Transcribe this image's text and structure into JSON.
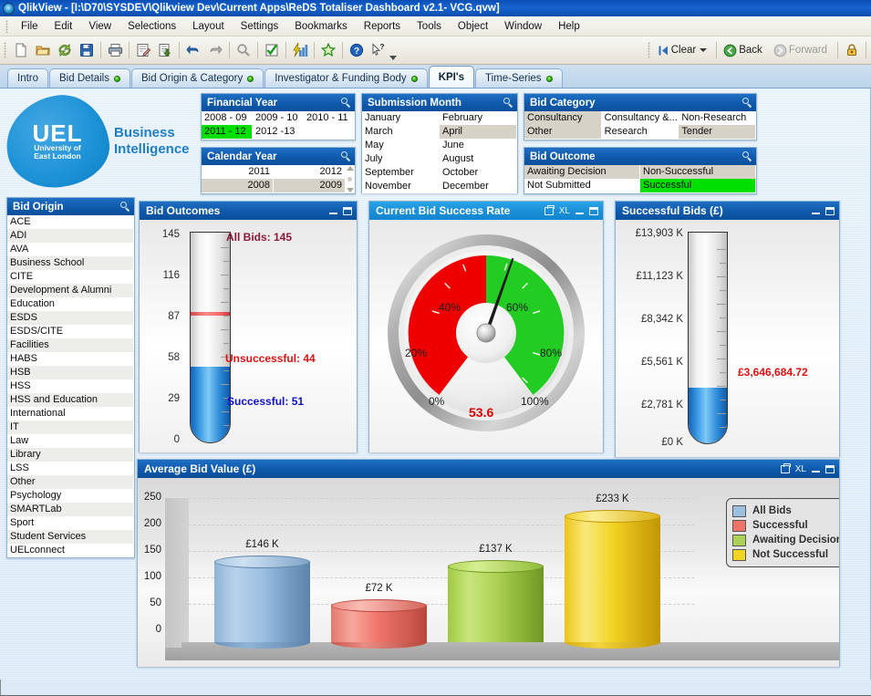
{
  "window": {
    "title": "QlikView - [I:\\D70\\SYSDEV\\Qlikview Dev\\Current Apps\\ReDS Totaliser Dashboard v2.1- VCG.qvw]",
    "app_icon": "qlikview-icon"
  },
  "menu": [
    "File",
    "Edit",
    "View",
    "Selections",
    "Layout",
    "Settings",
    "Bookmarks",
    "Reports",
    "Tools",
    "Object",
    "Window",
    "Help"
  ],
  "toolbar": {
    "buttons": [
      "new-document-icon",
      "open-folder-icon",
      "reload-icon",
      "save-icon",
      "print-icon",
      "edit-script-icon",
      "export-icon",
      "undo-icon",
      "redo-icon",
      "search-icon",
      "check-icon",
      "quick-chart-icon",
      "favorite-icon",
      "help-icon",
      "context-help-icon"
    ],
    "clear_label": "Clear",
    "back_label": "Back",
    "forward_label": "Forward",
    "lock_icon": "lock-icon"
  },
  "tabs": [
    {
      "label": "Intro",
      "dot": false,
      "active": false
    },
    {
      "label": "Bid Details",
      "dot": true,
      "active": false
    },
    {
      "label": "Bid Origin & Category",
      "dot": true,
      "active": false
    },
    {
      "label": "Investigator & Funding Body",
      "dot": true,
      "active": false
    },
    {
      "label": "KPI's",
      "dot": false,
      "active": true
    },
    {
      "label": "Time-Series",
      "dot": true,
      "active": false
    }
  ],
  "logo": {
    "acronym": "UEL",
    "line1": "University of",
    "line2": "East London",
    "bi_line1": "Business",
    "bi_line2": "Intelligence"
  },
  "filters": {
    "financial_year": {
      "title": "Financial Year",
      "rows": [
        [
          {
            "t": "2008 - 09",
            "s": "plain"
          },
          {
            "t": "2009 - 10",
            "s": "plain"
          },
          {
            "t": "2010 - 11",
            "s": "plain"
          }
        ],
        [
          {
            "t": "2011 - 12",
            "s": "sel-green"
          },
          {
            "t": "2012 -13",
            "s": "plain"
          },
          {
            "t": "",
            "s": "empty"
          }
        ]
      ]
    },
    "calendar_year": {
      "title": "Calendar Year",
      "rows": [
        [
          {
            "t": "2011",
            "s": "plain"
          },
          {
            "t": "2012",
            "s": "plain"
          }
        ],
        [
          {
            "t": "2008",
            "s": "sel-grey"
          },
          {
            "t": "2009",
            "s": "sel-grey"
          }
        ]
      ]
    },
    "submission_month": {
      "title": "Submission Month",
      "rows": [
        [
          {
            "t": "January",
            "s": "plain"
          },
          {
            "t": "February",
            "s": "plain"
          }
        ],
        [
          {
            "t": "March",
            "s": "plain"
          },
          {
            "t": "April",
            "s": "sel-grey"
          }
        ],
        [
          {
            "t": "May",
            "s": "plain"
          },
          {
            "t": "June",
            "s": "plain"
          }
        ],
        [
          {
            "t": "July",
            "s": "plain"
          },
          {
            "t": "August",
            "s": "plain"
          }
        ],
        [
          {
            "t": "September",
            "s": "plain"
          },
          {
            "t": "October",
            "s": "plain"
          }
        ],
        [
          {
            "t": "November",
            "s": "plain"
          },
          {
            "t": "December",
            "s": "plain"
          }
        ]
      ]
    },
    "bid_category": {
      "title": "Bid Category",
      "rows": [
        [
          {
            "t": "Consultancy",
            "s": "sel-grey"
          },
          {
            "t": "Consultancy &...",
            "s": "plain"
          },
          {
            "t": "Non-Research",
            "s": "plain"
          }
        ],
        [
          {
            "t": "Other",
            "s": "sel-grey"
          },
          {
            "t": "Research",
            "s": "plain"
          },
          {
            "t": "Tender",
            "s": "sel-grey"
          }
        ]
      ]
    },
    "bid_outcome": {
      "title": "Bid Outcome",
      "rows": [
        [
          {
            "t": "Awaiting Decision",
            "s": "sel-grey"
          },
          {
            "t": "Non-Successful",
            "s": "sel-grey"
          }
        ],
        [
          {
            "t": "Not Submitted",
            "s": "plain"
          },
          {
            "t": "Successful",
            "s": "sel-green"
          }
        ]
      ]
    },
    "bid_origin": {
      "title": "Bid Origin",
      "items": [
        "ACE",
        "ADI",
        "AVA",
        "Business School",
        "CITE",
        "Development & Alumni",
        "Education",
        "ESDS",
        "ESDS/CITE",
        "Facilities",
        "HABS",
        "HSB",
        "HSS",
        "HSS and Education",
        "International",
        "IT",
        "Law",
        "Library",
        "LSS",
        "Other",
        "Psychology",
        "SMARTLab",
        "Sport",
        "Student Services",
        "UELconnect"
      ]
    }
  },
  "panels": {
    "bid_outcomes": {
      "title": "Bid Outcomes",
      "all_bids_label": "All Bids: 145",
      "unsuccessful_label": "Unsuccessful: 44",
      "successful_label": "Successful: 51"
    },
    "success_rate": {
      "title": "Current Bid Success Rate"
    },
    "successful_bids": {
      "title": "Successful Bids  (£)",
      "value_label": "£3,646,684.72"
    },
    "avg_bid_value": {
      "title": "Average Bid Value (£)"
    }
  },
  "chart_data": [
    {
      "type": "bar",
      "name": "bid-outcomes-thermometer",
      "title": "Bid Outcomes",
      "orientation": "vertical-thermometer",
      "categories": [
        "All Bids",
        "Unsuccessful",
        "Successful"
      ],
      "values": [
        145,
        44,
        51
      ],
      "fill_value": 51,
      "marker_value": 95,
      "ylim": [
        0,
        145
      ],
      "ytick_labels": [
        "0",
        "29",
        "58",
        "87",
        "116",
        "145"
      ],
      "ytick_values": [
        0,
        29,
        58,
        87,
        116,
        145
      ],
      "annotations": [
        "All Bids: 145",
        "Unsuccessful: 44",
        "Successful: 51"
      ],
      "colors": {
        "all_bids": "#8b1a3a",
        "unsuccessful": "#dd1111",
        "successful": "#1111cc",
        "fill": "#2b8ad8",
        "marker": "#ff6a6a"
      }
    },
    {
      "type": "gauge",
      "name": "current-bid-success-rate",
      "title": "Current Bid Success Rate",
      "value": 53.6,
      "value_label": "53.6",
      "min": 0,
      "max": 100,
      "unit": "%",
      "tick_labels": [
        "0%",
        "20%",
        "40%",
        "60%",
        "80%",
        "100%"
      ],
      "tick_values": [
        0,
        20,
        40,
        60,
        80,
        100
      ],
      "segments": [
        {
          "from": 0,
          "to": 50,
          "color": "#ee0000"
        },
        {
          "from": 50,
          "to": 100,
          "color": "#22cc22"
        }
      ]
    },
    {
      "type": "bar",
      "name": "successful-bids-thermometer",
      "title": "Successful Bids  (£)",
      "orientation": "vertical-thermometer",
      "value": 3646684.72,
      "value_label": "£3,646,684.72",
      "ylim": [
        0,
        13903000
      ],
      "ytick_labels": [
        "£0 K",
        "£2,781 K",
        "£5,561 K",
        "£8,342 K",
        "£11,123 K",
        "£13,903 K"
      ],
      "ytick_values": [
        0,
        2781000,
        5561000,
        8342000,
        11123000,
        13903000
      ],
      "colors": {
        "fill": "#2b8ad8",
        "value": "#dd1111"
      }
    },
    {
      "type": "bar",
      "name": "average-bid-value",
      "title": "Average Bid Value (£)",
      "categories": [
        "All Bids",
        "Successful",
        "Awaiting Decision",
        "Not Successful"
      ],
      "values": [
        146,
        72,
        137,
        233
      ],
      "data_labels": [
        "£146 K",
        "£72 K",
        "£137 K",
        "£233 K"
      ],
      "ylabel": "",
      "xlabel": "",
      "ylim": [
        0,
        275
      ],
      "ytick_labels": [
        "0",
        "50",
        "100",
        "150",
        "200",
        "250"
      ],
      "ytick_values": [
        0,
        50,
        100,
        150,
        200,
        250
      ],
      "grid": true,
      "legend_position": "top-right",
      "legend": [
        {
          "label": "All Bids",
          "color": "#9cc0e0"
        },
        {
          "label": "Successful",
          "color": "#f0736a"
        },
        {
          "label": "Awaiting Decision",
          "color": "#a8d44a"
        },
        {
          "label": "Not Successful",
          "color": "#f5d423"
        }
      ]
    }
  ]
}
